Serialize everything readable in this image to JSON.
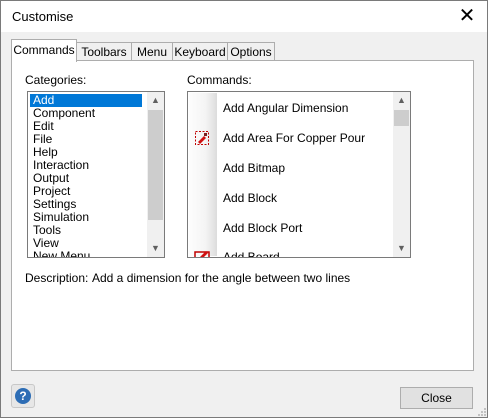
{
  "window": {
    "title": "Customise",
    "close_glyph": "✕"
  },
  "tabs": [
    {
      "label": "Commands",
      "active": true
    },
    {
      "label": "Toolbars"
    },
    {
      "label": "Menu"
    },
    {
      "label": "Keyboard"
    },
    {
      "label": "Options"
    }
  ],
  "categories": {
    "label": "Categories:",
    "items": [
      "Add",
      "Component",
      "Edit",
      "File",
      "Help",
      "Interaction",
      "Output",
      "Project",
      "Settings",
      "Simulation",
      "Tools",
      "View",
      "New Menu"
    ],
    "selected": "Add"
  },
  "commands": {
    "label": "Commands:",
    "items": [
      {
        "label": "Add Angular Dimension",
        "icon": "none"
      },
      {
        "label": "Add Area For Copper Pour",
        "icon": "copper-pour-area-icon"
      },
      {
        "label": "Add Bitmap",
        "icon": "none"
      },
      {
        "label": "Add Block",
        "icon": "none"
      },
      {
        "label": "Add Block Port",
        "icon": "none"
      },
      {
        "label": "Add Board",
        "icon": "board-icon"
      }
    ]
  },
  "description": {
    "label": "Description:",
    "text": "Add a dimension for the angle between two lines"
  },
  "buttons": {
    "close": "Close",
    "help_glyph": "?"
  },
  "colors": {
    "selection": "#0078d7",
    "help": "#2d6db5"
  }
}
